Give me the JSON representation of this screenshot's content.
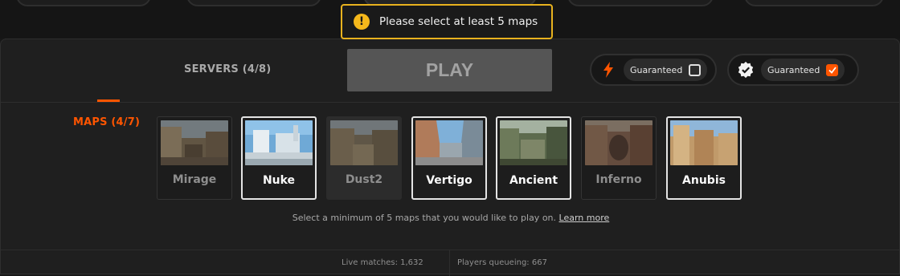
{
  "toast": {
    "message": "Please select at least 5 maps",
    "icon": "warning-icon",
    "color": "#e8b21e"
  },
  "tabs": [
    {
      "label": "MAPS (4/7)",
      "active": true
    },
    {
      "label": "SERVERS (4/8)",
      "active": false
    }
  ],
  "play_button": {
    "label": "PLAY",
    "enabled": false
  },
  "guaranteed": [
    {
      "icon": "lightning-icon",
      "label": "Guaranteed",
      "checked": false
    },
    {
      "icon": "verified-badge-icon",
      "label": "Guaranteed",
      "checked": true
    }
  ],
  "maps": [
    {
      "name": "Mirage",
      "selected": false
    },
    {
      "name": "Nuke",
      "selected": true
    },
    {
      "name": "Dust2",
      "selected": false
    },
    {
      "name": "Vertigo",
      "selected": true
    },
    {
      "name": "Ancient",
      "selected": true
    },
    {
      "name": "Inferno",
      "selected": false
    },
    {
      "name": "Anubis",
      "selected": true
    }
  ],
  "hint": {
    "text": "Select a minimum of 5 maps that you would like to play on.",
    "link": "Learn more"
  },
  "stats": {
    "live_matches": "Live matches: 1,632",
    "players_queueing": "Players queueing: 667"
  },
  "colors": {
    "accent": "#ff5500",
    "warning": "#f5b81b",
    "panel": "#1f1f1f"
  }
}
